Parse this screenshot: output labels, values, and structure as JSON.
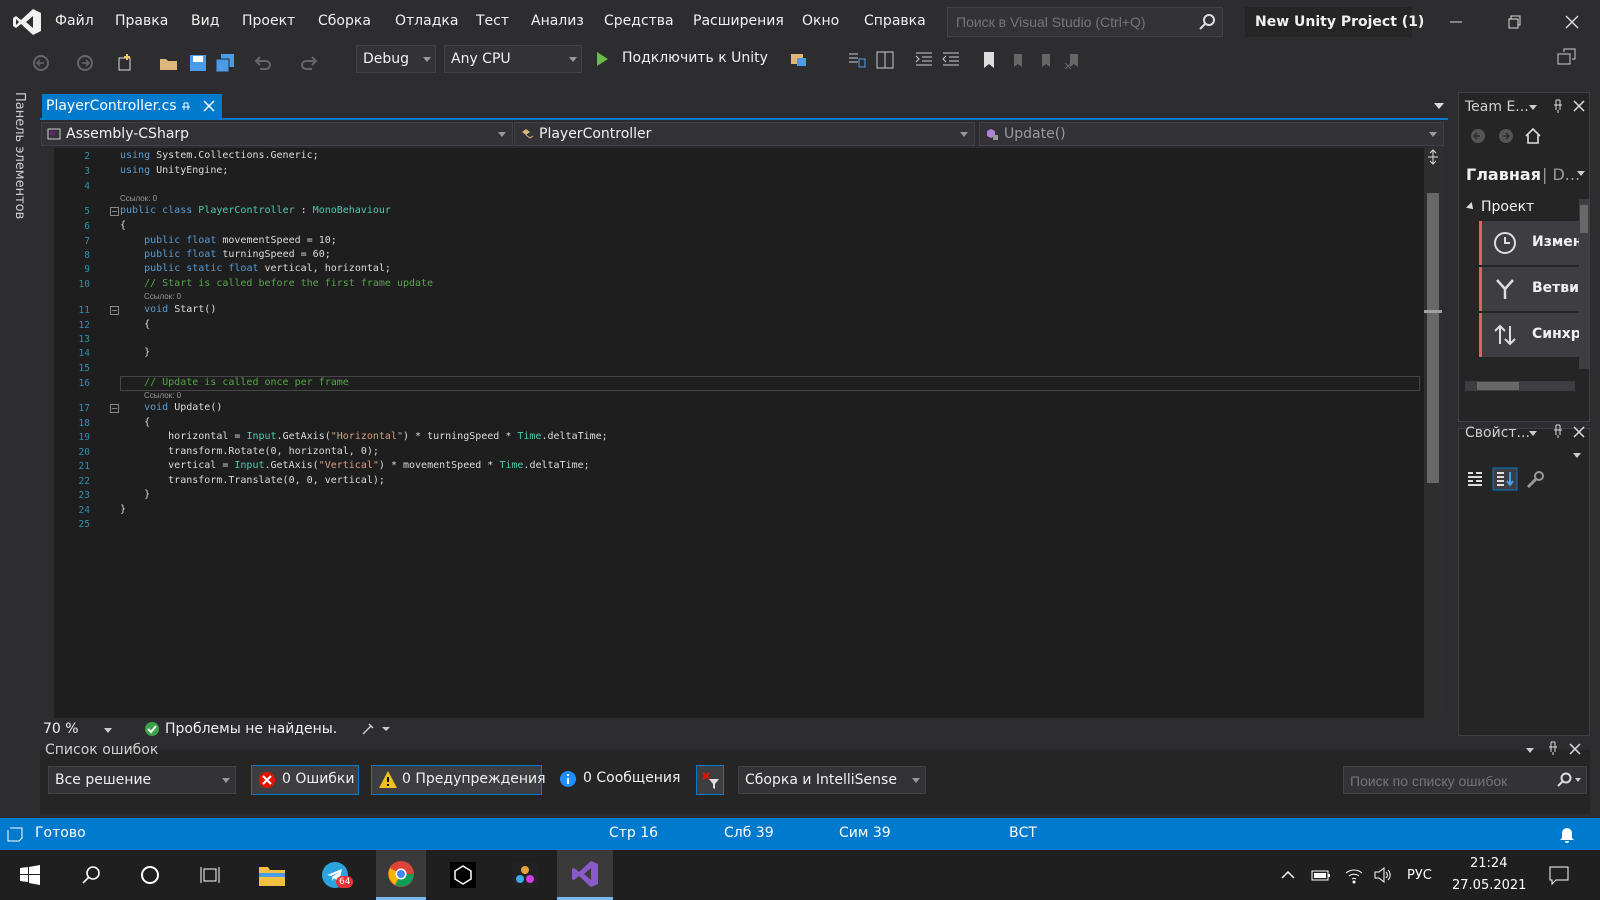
{
  "menu": {
    "items": [
      "Файл",
      "Правка",
      "Вид",
      "Проект",
      "Сборка",
      "Отладка",
      "Тест",
      "Анализ",
      "Средства",
      "Расширения",
      "Окно",
      "Справка"
    ],
    "search_placeholder": "Поиск в Visual Studio (Ctrl+Q)",
    "project_title": "New Unity Project (1)"
  },
  "toolbar": {
    "config": "Debug",
    "platform": "Any CPU",
    "start_label": "Подключить к Unity"
  },
  "left_tool": {
    "label": "Панель элементов"
  },
  "tab": {
    "file": "PlayerController.cs"
  },
  "navbar": {
    "project": "Assembly-CSharp",
    "class": "PlayerController",
    "member": "Update()"
  },
  "code": {
    "lens_label": "Ссылок: 0",
    "lines": [
      {
        "n": "2",
        "text": "using System.Collections.Generic;"
      },
      {
        "n": "3",
        "text": "using UnityEngine;"
      },
      {
        "n": "4",
        "text": ""
      },
      {
        "n": "5",
        "text": "public class PlayerController : MonoBehaviour"
      },
      {
        "n": "6",
        "text": "{"
      },
      {
        "n": "7",
        "text": "    public float movementSpeed = 10;"
      },
      {
        "n": "8",
        "text": "    public float turningSpeed = 60;"
      },
      {
        "n": "9",
        "text": "    public static float vertical, horizontal;"
      },
      {
        "n": "10",
        "text": "    // Start is called before the first frame update"
      },
      {
        "n": "11",
        "text": "    void Start()"
      },
      {
        "n": "12",
        "text": "    {"
      },
      {
        "n": "13",
        "text": ""
      },
      {
        "n": "14",
        "text": "    }"
      },
      {
        "n": "15",
        "text": ""
      },
      {
        "n": "16",
        "text": "    // Update is called once per frame"
      },
      {
        "n": "17",
        "text": "    void Update()"
      },
      {
        "n": "18",
        "text": "    {"
      },
      {
        "n": "19",
        "text": "        horizontal = Input.GetAxis(\"Horizontal\") * turningSpeed * Time.deltaTime;"
      },
      {
        "n": "20",
        "text": "        transform.Rotate(0, horizontal, 0);"
      },
      {
        "n": "21",
        "text": "        vertical = Input.GetAxis(\"Vertical\") * movementSpeed * Time.deltaTime;"
      },
      {
        "n": "22",
        "text": "        transform.Translate(0, 0, vertical);"
      },
      {
        "n": "23",
        "text": "    }"
      },
      {
        "n": "24",
        "text": "}"
      },
      {
        "n": "25",
        "text": ""
      }
    ]
  },
  "editor_status": {
    "zoom": "70 %",
    "issues": "Проблемы не найдены."
  },
  "team_explorer": {
    "title": "Team E...",
    "home": "Главная",
    "home_suffix": "D...",
    "section": "Проект",
    "items": [
      "Измен",
      "Ветви",
      "Синхр"
    ]
  },
  "properties": {
    "title": "Свойст..."
  },
  "error_list": {
    "title": "Список ошибок",
    "scope": "Все решение",
    "errors": "0 Ошибки",
    "warnings": "0 Предупреждения",
    "messages": "0 Сообщения",
    "source": "Сборка и IntelliSense",
    "search_placeholder": "Поиск по списку ошибок"
  },
  "status": {
    "ready": "Готово",
    "line": "Стр 16",
    "col": "Слб 39",
    "ch": "Сим 39",
    "mode": "ВСТ"
  },
  "taskbar": {
    "telegram_badge": "64",
    "lang": "РУС",
    "time": "21:24",
    "date": "27.05.2021"
  }
}
